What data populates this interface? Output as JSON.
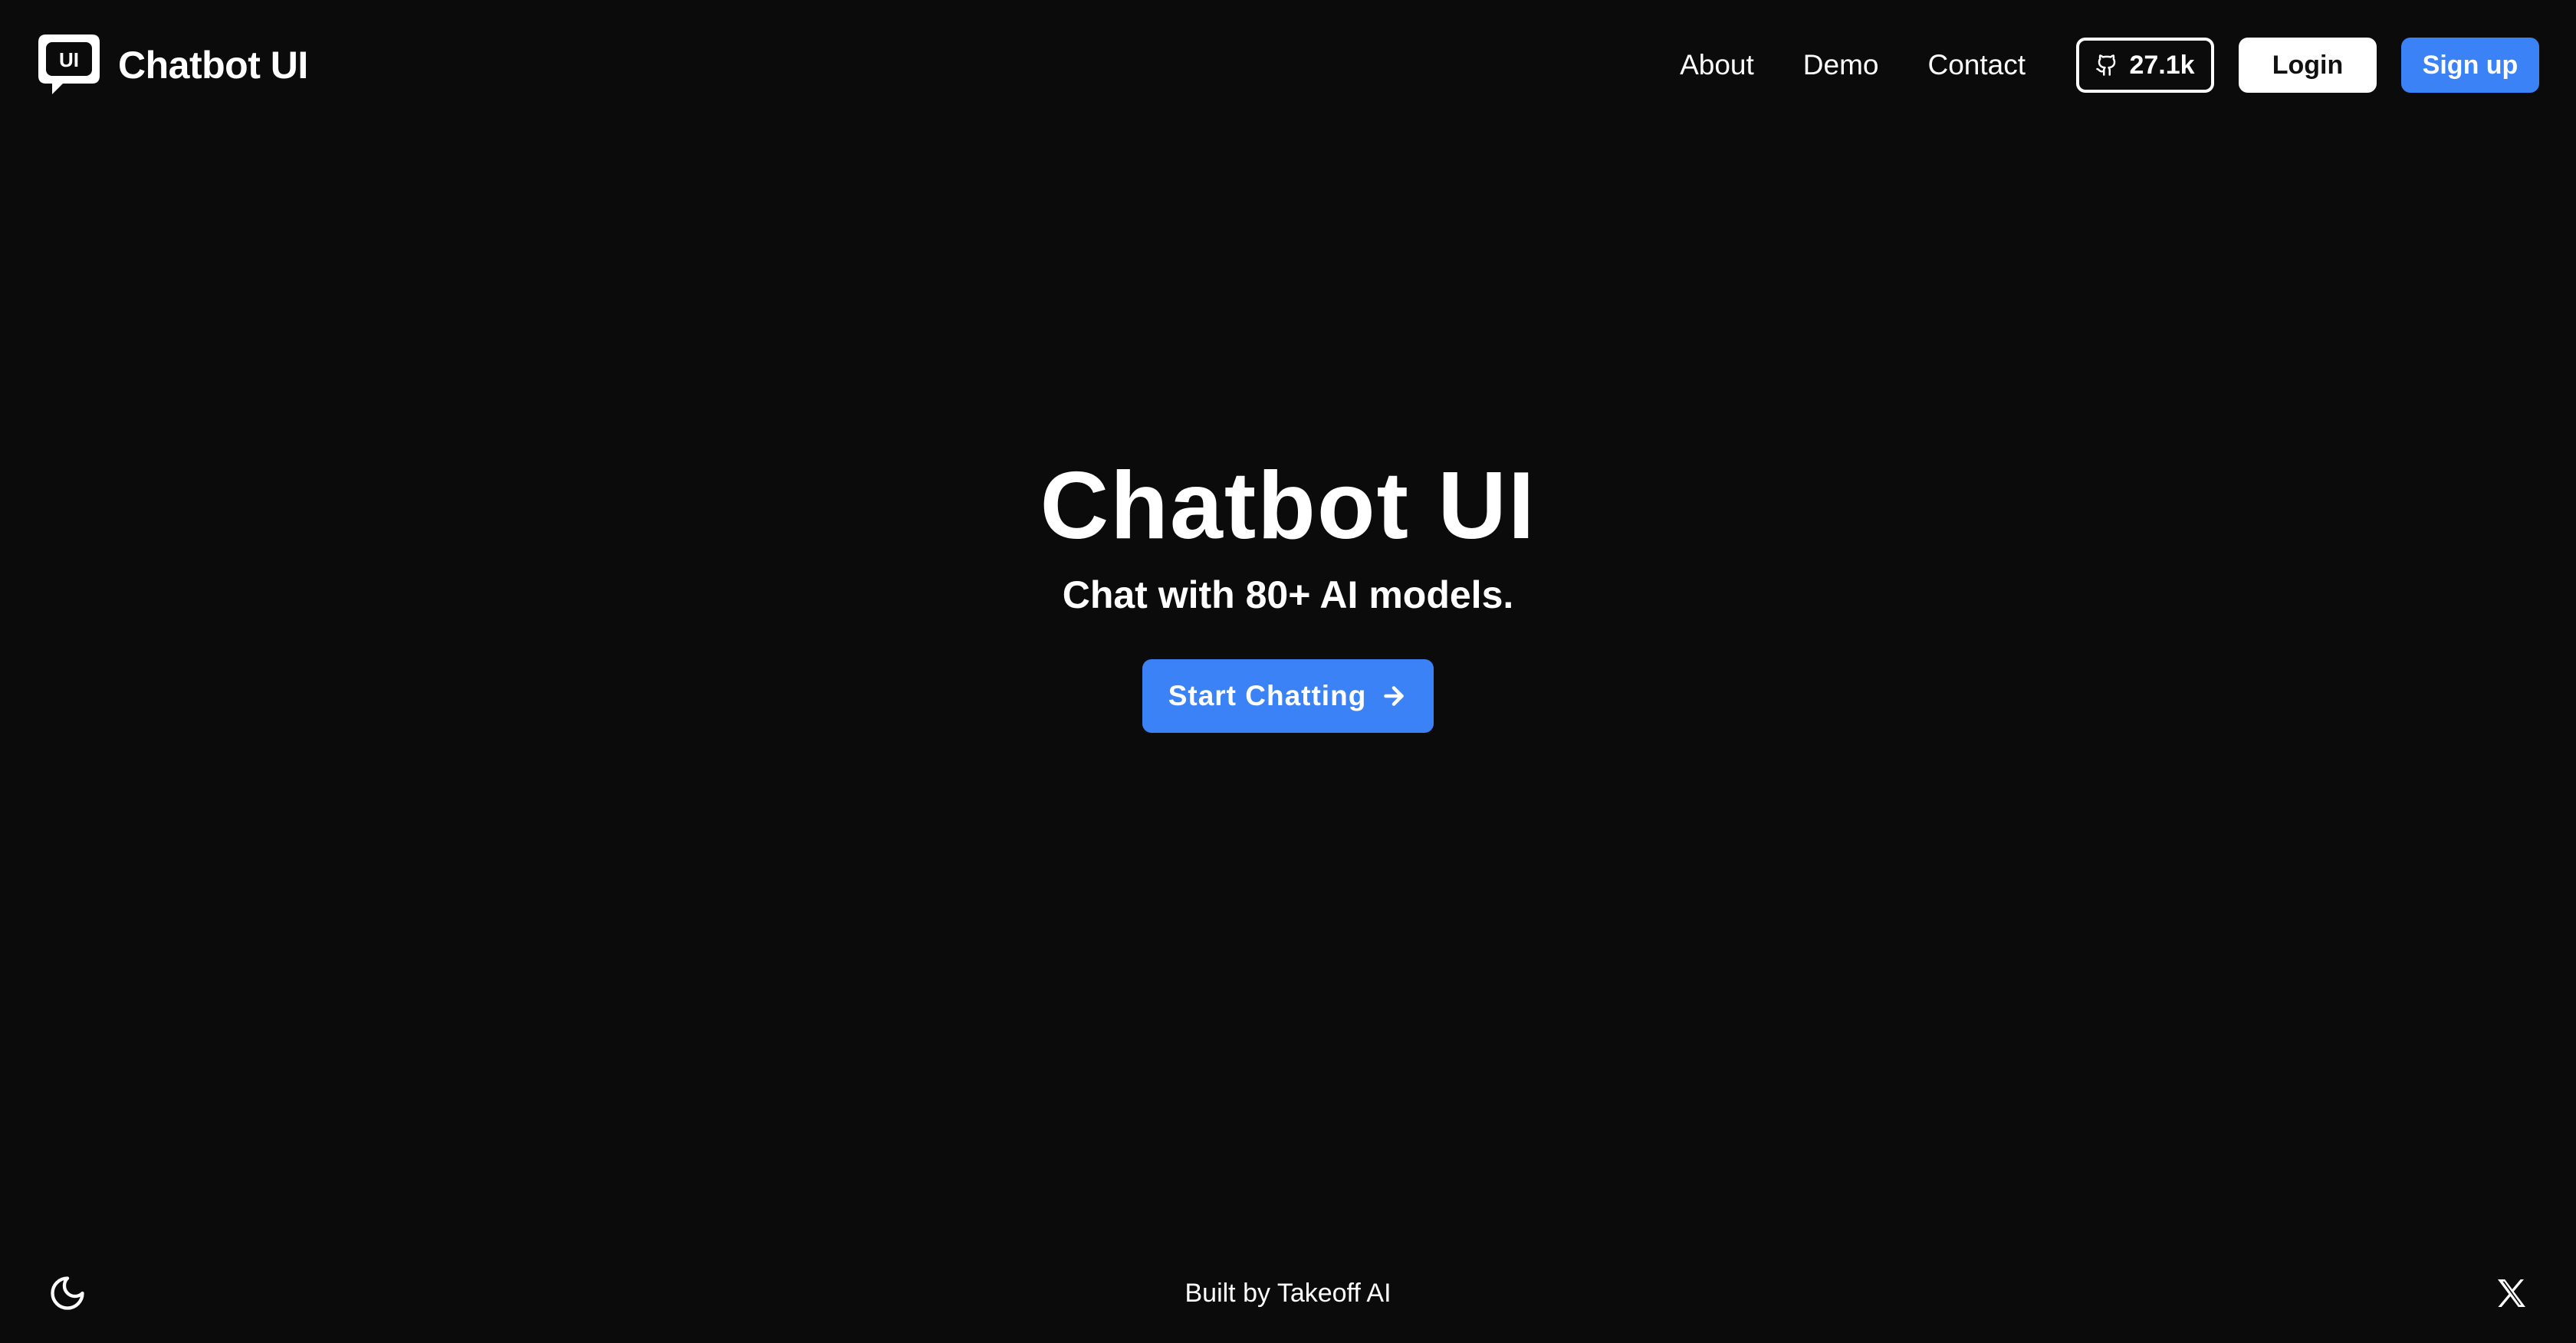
{
  "header": {
    "brand_name": "Chatbot UI",
    "logo_text": "UI",
    "nav": {
      "about": "About",
      "demo": "Demo",
      "contact": "Contact"
    },
    "github_stars": "27.1k",
    "login_label": "Login",
    "signup_label": "Sign up"
  },
  "hero": {
    "title": "Chatbot UI",
    "subtitle": "Chat with 80+ AI models.",
    "cta_label": "Start Chatting"
  },
  "footer": {
    "text": "Built by Takeoff AI"
  },
  "icons": {
    "logo": "chat-bubble-logo",
    "github": "github-icon",
    "arrow": "arrow-right-icon",
    "theme": "moon-icon",
    "social": "x-icon"
  },
  "colors": {
    "background": "#0b0b0b",
    "accent": "#3b82f6",
    "text": "#ffffff"
  }
}
